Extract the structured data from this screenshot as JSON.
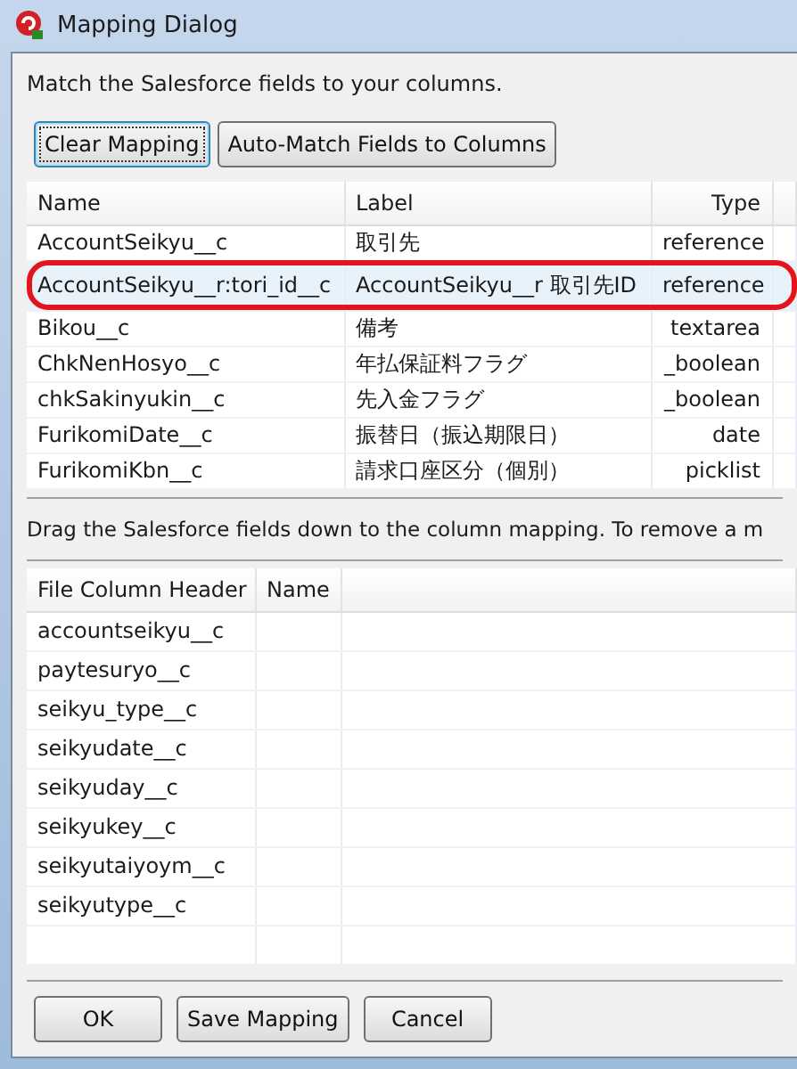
{
  "window": {
    "title": "Mapping Dialog"
  },
  "instruction": "Match the Salesforce fields to your columns.",
  "top_buttons": [
    {
      "label": "Clear Mapping",
      "focused": true
    },
    {
      "label": "Auto-Match Fields to Columns",
      "focused": false
    }
  ],
  "fields_table": {
    "columns": [
      "Name",
      "Label",
      "Type"
    ],
    "rows": [
      {
        "name": "AccountSeikyu__c",
        "label": "取引先",
        "type": "reference",
        "selected": false,
        "annotated": false
      },
      {
        "name": "AccountSeikyu__r:tori_id__c",
        "label": "AccountSeikyu__r 取引先ID",
        "type": "reference",
        "selected": true,
        "annotated": true
      },
      {
        "name": "Bikou__c",
        "label": "備考",
        "type": "textarea",
        "selected": false,
        "annotated": false
      },
      {
        "name": "ChkNenHosyo__c",
        "label": "年払保証料フラグ",
        "type": "_boolean",
        "selected": false,
        "annotated": false
      },
      {
        "name": "chkSakinyukin__c",
        "label": "先入金フラグ",
        "type": "_boolean",
        "selected": false,
        "annotated": false
      },
      {
        "name": "FurikomiDate__c",
        "label": "振替日（振込期限日）",
        "type": "date",
        "selected": false,
        "annotated": false
      },
      {
        "name": "FurikomiKbn__c",
        "label": "請求口座区分（個別）",
        "type": "picklist",
        "selected": false,
        "annotated": false
      }
    ]
  },
  "drag_hint": "Drag the Salesforce fields down to the column mapping.  To remove a m",
  "mapping_table": {
    "columns": [
      "File Column Header",
      "Name"
    ],
    "rows": [
      {
        "header": "accountseikyu__c"
      },
      {
        "header": "paytesuryo__c"
      },
      {
        "header": "seikyu_type__c"
      },
      {
        "header": "seikyudate__c"
      },
      {
        "header": "seikyuday__c"
      },
      {
        "header": "seikyukey__c"
      },
      {
        "header": "seikyutaiyoym__c"
      },
      {
        "header": "seikyutype__c"
      }
    ]
  },
  "bottom_buttons": [
    "OK",
    "Save Mapping",
    "Cancel"
  ]
}
